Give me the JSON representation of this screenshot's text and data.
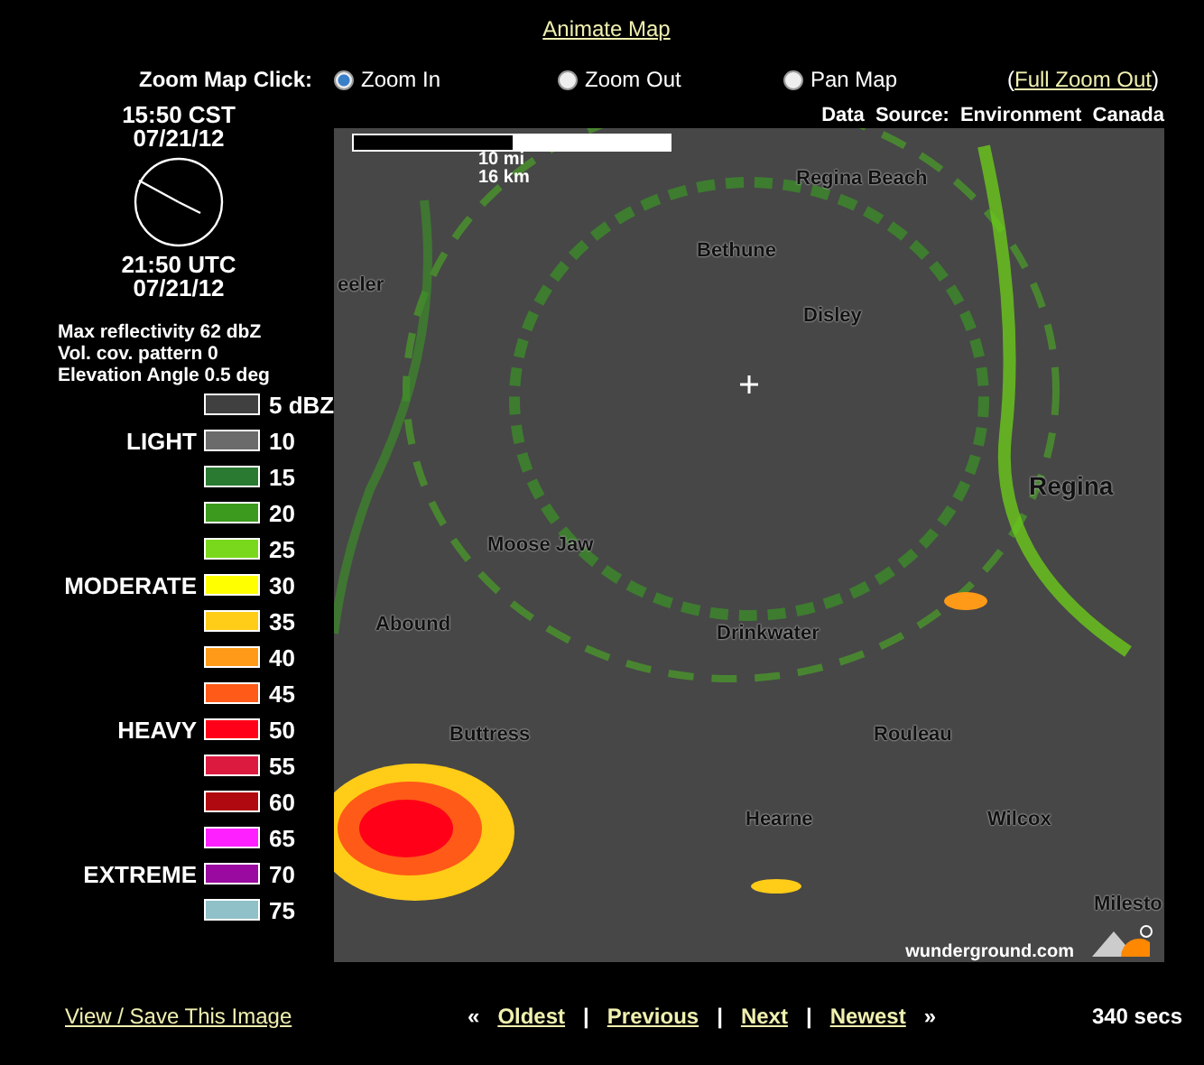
{
  "animate_link": "Animate Map",
  "zoom_controls": {
    "label": "Zoom Map Click:",
    "options": [
      {
        "label": "Zoom In",
        "selected": true
      },
      {
        "label": "Zoom Out",
        "selected": false
      },
      {
        "label": "Pan Map",
        "selected": false
      }
    ],
    "full_zoom": {
      "open": "(",
      "link": "Full Zoom Out",
      "close": ")"
    }
  },
  "data_source": "Data Source: Environment Canada",
  "clock": {
    "local_time": "15:50 CST",
    "local_date": "07/21/12",
    "utc_time": "21:50 UTC",
    "utc_date": "07/21/12"
  },
  "radar_info": [
    "Max reflectivity 62 dbZ",
    "Vol. cov. pattern 0",
    "Elevation Angle 0.5 deg"
  ],
  "legend": [
    {
      "color": "#404040",
      "value": "5 dBZ"
    },
    {
      "intensity": "LIGHT",
      "color": "#6b6b6b",
      "value": "10"
    },
    {
      "color": "#2a7a32",
      "value": "15"
    },
    {
      "color": "#3c9a1e",
      "value": "20"
    },
    {
      "color": "#7ad81c",
      "value": "25"
    },
    {
      "intensity": "MODERATE",
      "color": "#ffff00",
      "value": "30"
    },
    {
      "color": "#ffcc18",
      "value": "35"
    },
    {
      "color": "#ff9a18",
      "value": "40"
    },
    {
      "color": "#ff5a18",
      "value": "45"
    },
    {
      "intensity": "HEAVY",
      "color": "#ff0018",
      "value": "50"
    },
    {
      "color": "#dc1a40",
      "value": "55"
    },
    {
      "color": "#b00a10",
      "value": "60"
    },
    {
      "color": "#ff20ff",
      "value": "65"
    },
    {
      "intensity": "EXTREME",
      "color": "#9a0aa0",
      "value": "70"
    },
    {
      "color": "#90c0c8",
      "value": "75"
    }
  ],
  "map": {
    "scale": [
      "10 mi",
      "16 km"
    ],
    "places": [
      "Regina Beach",
      "Bethune",
      "Disley",
      "eeler",
      "Regina",
      "Moose Jaw",
      "Abound",
      "Drinkwater",
      "Buttress",
      "Rouleau",
      "Hearne",
      "Wilcox",
      "Milesto"
    ],
    "branding": "wunderground.com"
  },
  "footer": {
    "save_link": "View / Save This Image",
    "nav": [
      {
        "kind": "mark",
        "text": "«"
      },
      {
        "kind": "link",
        "text": "Oldest"
      },
      {
        "kind": "sep",
        "text": "|"
      },
      {
        "kind": "link",
        "text": "Previous"
      },
      {
        "kind": "sep",
        "text": "|"
      },
      {
        "kind": "link",
        "text": "Next"
      },
      {
        "kind": "sep",
        "text": "|"
      },
      {
        "kind": "link",
        "text": "Newest"
      },
      {
        "kind": "mark",
        "text": "»"
      }
    ],
    "delay": "340 secs"
  }
}
